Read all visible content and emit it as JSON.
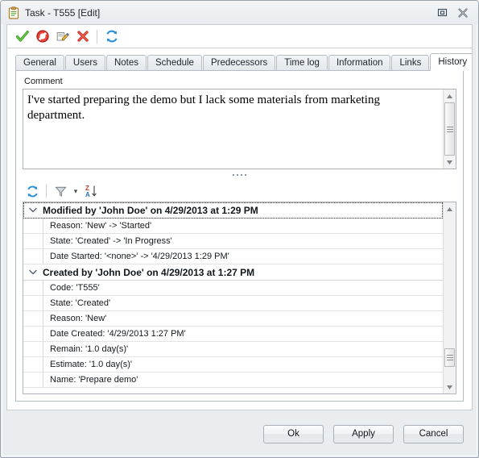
{
  "window": {
    "title": "Task - T555 [Edit]",
    "icon": "clipboard-icon",
    "restore_label": "❐",
    "close_label": "✖"
  },
  "toolbar": {
    "items": [
      {
        "name": "accept-icon",
        "tooltip": "Accept"
      },
      {
        "name": "reject-icon",
        "tooltip": "Reject"
      },
      {
        "name": "edit-icon",
        "tooltip": "Edit"
      },
      {
        "name": "delete-icon",
        "tooltip": "Delete"
      },
      {
        "name": "refresh-icon",
        "tooltip": "Refresh"
      }
    ]
  },
  "tabs": [
    {
      "label": "General",
      "active": false
    },
    {
      "label": "Users",
      "active": false
    },
    {
      "label": "Notes",
      "active": false
    },
    {
      "label": "Schedule",
      "active": false
    },
    {
      "label": "Predecessors",
      "active": false
    },
    {
      "label": "Time log",
      "active": false
    },
    {
      "label": "Information",
      "active": false
    },
    {
      "label": "Links",
      "active": false
    },
    {
      "label": "History",
      "active": true
    }
  ],
  "comment": {
    "label": "Comment",
    "value": "I've started preparing the demo but I lack some materials from marketing department."
  },
  "list_toolbar": {
    "refresh_label": "refresh-icon",
    "filter_label": "filter-icon",
    "filter_caret": "▾",
    "sort_label": "sort-za-icon"
  },
  "history": {
    "groups": [
      {
        "title": "Modified by 'John Doe' on 4/29/2013 at 1:29 PM",
        "expanded": true,
        "focused": true,
        "rows": [
          "Reason: 'New' -> 'Started'",
          "State: 'Created' -> 'In Progress'",
          "Date Started: '<none>' -> '4/29/2013 1:29 PM'"
        ]
      },
      {
        "title": "Created by 'John Doe' on 4/29/2013 at 1:27 PM",
        "expanded": true,
        "focused": false,
        "rows": [
          "Code: 'T555'",
          "State: 'Created'",
          "Reason: 'New'",
          "Date Created: '4/29/2013 1:27 PM'",
          "Remain: '1.0 day(s)'",
          "Estimate: '1.0 day(s)'",
          "Name: 'Prepare demo'"
        ]
      }
    ]
  },
  "footer": {
    "ok_label": "Ok",
    "apply_label": "Apply",
    "cancel_label": "Cancel"
  },
  "colors": {
    "accent_green": "#3aa525",
    "accent_red": "#d5281f",
    "accent_blue": "#2a8fd8",
    "window_bg": "#eaedf0",
    "border": "#b6bcc3"
  }
}
